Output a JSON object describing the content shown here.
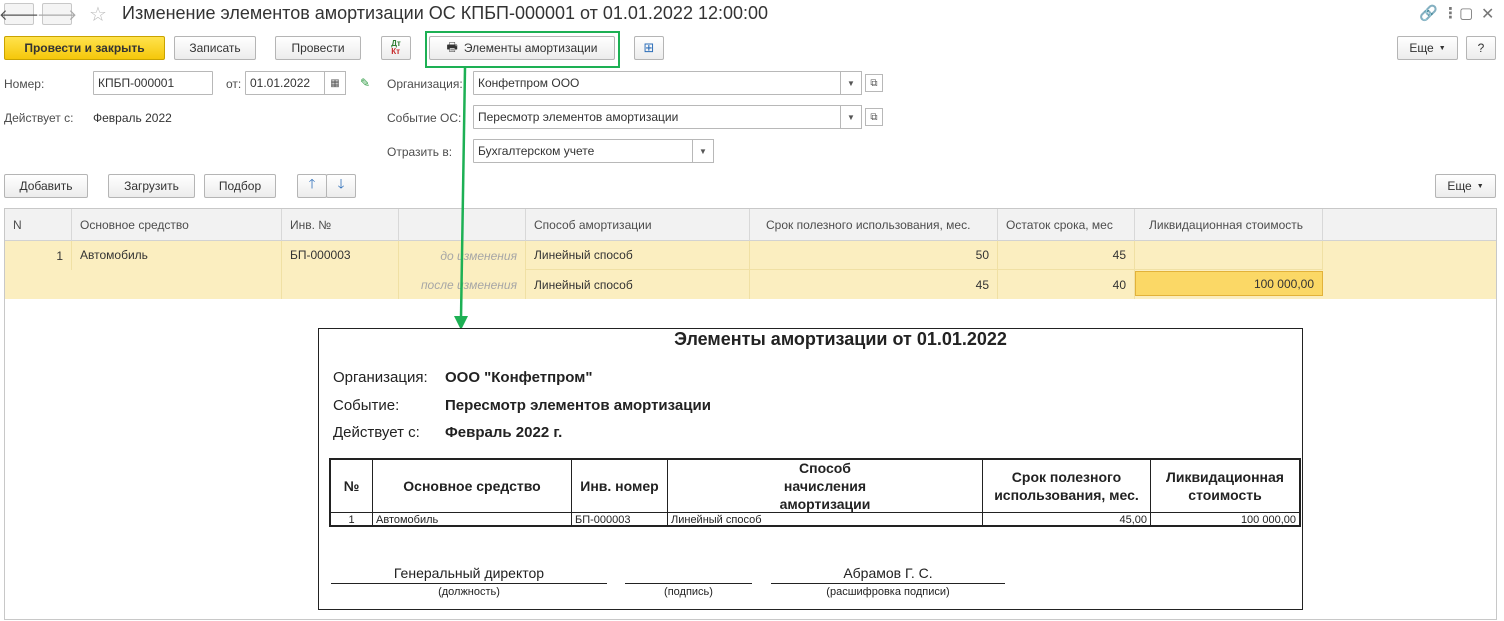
{
  "window": {
    "title": "Изменение элементов амортизации ОС КПБП-000001 от 01.01.2022 12:00:00"
  },
  "toolbar": {
    "post_close": "Провести и закрыть",
    "save": "Записать",
    "post": "Провести",
    "dtkt_top": "Дт",
    "dtkt_bottom": "Кт",
    "print_elements": "Элементы амортизации",
    "more": "Еще",
    "help": "?"
  },
  "form": {
    "number_label": "Номер:",
    "number_value": "КПБП-000001",
    "date_label": "от:",
    "date_value": "01.01.2022",
    "org_label": "Организация:",
    "org_value": "Конфетпром ООО",
    "effective_label": "Действует с:",
    "effective_value": "Февраль 2022",
    "event_label": "Событие ОС:",
    "event_value": "Пересмотр элементов амортизации",
    "reflect_label": "Отразить в:",
    "reflect_value": "Бухгалтерском учете"
  },
  "table_toolbar": {
    "add": "Добавить",
    "load": "Загрузить",
    "pick": "Подбор",
    "more": "Еще"
  },
  "grid": {
    "headers": [
      "N",
      "Основное средство",
      "Инв. №",
      "",
      "Способ амортизации",
      "Срок полезного использования, мес.",
      "Остаток срока, мес",
      "Ликвидационная стоимость"
    ],
    "row": {
      "n": "1",
      "asset": "Автомобиль",
      "inv": "БП-000003",
      "before_label": "до изменения",
      "after_label": "после изменения",
      "before_method": "Линейный способ",
      "after_method": "Линейный способ",
      "before_term": "50",
      "after_term": "45",
      "before_rest": "45",
      "after_rest": "40",
      "before_liq": "",
      "after_liq": "100 000,00"
    }
  },
  "print_form": {
    "title": "Элементы амортизации от 01.01.2022",
    "org_label": "Организация:",
    "org_value": "ООО \"Конфетпром\"",
    "event_label": "Событие:",
    "event_value": "Пересмотр элементов амортизации",
    "effective_label": "Действует с:",
    "effective_value": "Февраль 2022 г.",
    "headers": [
      "№",
      "Основное средство",
      "Инв. номер",
      "Способ начисления амортизации",
      "Срок полезного использования, мес.",
      "Ликвидационная стоимость"
    ],
    "row": [
      "1",
      "Автомобиль",
      "БП-000003",
      "Линейный способ",
      "45,00",
      "100 000,00"
    ],
    "signatures": {
      "position": "Генеральный директор",
      "position_caption": "(должность)",
      "signature_caption": "(подпись)",
      "name": "Абрамов Г. С.",
      "name_caption": "(расшифровка подписи)"
    }
  },
  "colors": {
    "primary_button": "#f5c70a",
    "selected_row": "#fbeec0",
    "active_cell": "#fbd866",
    "callout": "#1db054"
  }
}
